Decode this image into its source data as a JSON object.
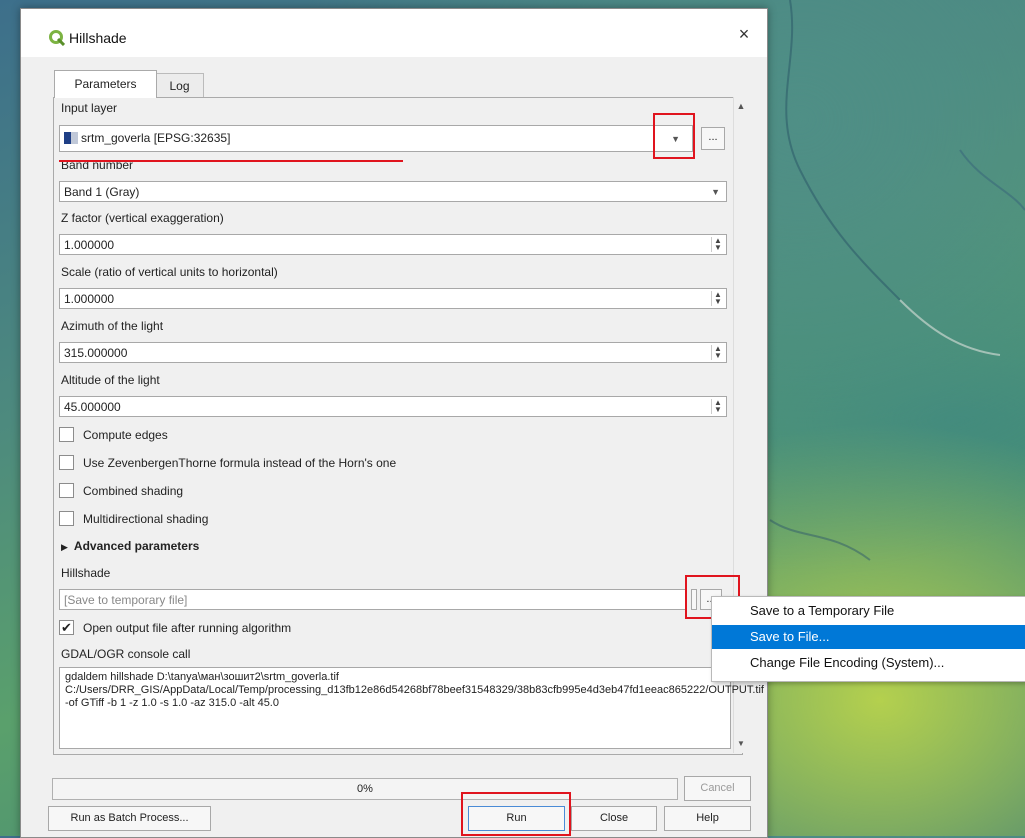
{
  "window": {
    "title": "Hillshade",
    "close": "×"
  },
  "tabs": [
    {
      "label": "Parameters"
    },
    {
      "label": "Log"
    }
  ],
  "params": {
    "input_layer": {
      "label": "Input layer",
      "value": "srtm_goverla [EPSG:32635]",
      "browse": "..."
    },
    "band": {
      "label": "Band number",
      "value": "Band 1 (Gray)"
    },
    "zfactor": {
      "label": "Z factor (vertical exaggeration)",
      "value": "1.000000"
    },
    "scale": {
      "label": "Scale (ratio of vertical units to horizontal)",
      "value": "1.000000"
    },
    "azimuth": {
      "label": "Azimuth of the light",
      "value": "315.000000"
    },
    "altitude": {
      "label": "Altitude of the light",
      "value": "45.000000"
    },
    "checkboxes": [
      {
        "label": "Compute edges",
        "checked": false
      },
      {
        "label": "Use ZevenbergenThorne formula instead of the Horn's one",
        "checked": false
      },
      {
        "label": "Combined shading",
        "checked": false
      },
      {
        "label": "Multidirectional shading",
        "checked": false
      }
    ],
    "advanced": "Advanced parameters",
    "output": {
      "label": "Hillshade",
      "placeholder": "[Save to temporary file]",
      "browse": "..."
    },
    "open_output": {
      "label": "Open output file after running algorithm",
      "checked": true
    },
    "console": {
      "label": "GDAL/OGR console call",
      "text": "gdaldem hillshade D:\\tanya\\ман\\зошит2\\srtm_goverla.tif C:/Users/DRR_GIS/AppData/Local/Temp/processing_d13fb12e86d54268bf78beef31548329/38b83cfb995e4d3eb47fd1eeac865222/OUTPUT.tif -of GTiff -b 1 -z 1.0 -s 1.0 -az 315.0 -alt 45.0"
    }
  },
  "progress": {
    "text": "0%",
    "value": 0
  },
  "buttons": {
    "cancel": "Cancel",
    "batch": "Run as Batch Process...",
    "run": "Run",
    "close": "Close",
    "help": "Help"
  },
  "context_menu": [
    {
      "label": "Save to a Temporary File"
    },
    {
      "label": "Save to File..."
    },
    {
      "label": "Change File Encoding (System)..."
    }
  ],
  "colors": {
    "highlight": "#0078d7",
    "annotation": "#e0141e",
    "qgis_green": "#7cb342"
  },
  "icons": {
    "app": "qgis-logo-icon",
    "close": "close-icon",
    "dropdown": "chevron-down-icon",
    "spin": "spinbox-arrows-icon",
    "check": "checkmark-icon",
    "expand": "triangle-right-icon"
  }
}
